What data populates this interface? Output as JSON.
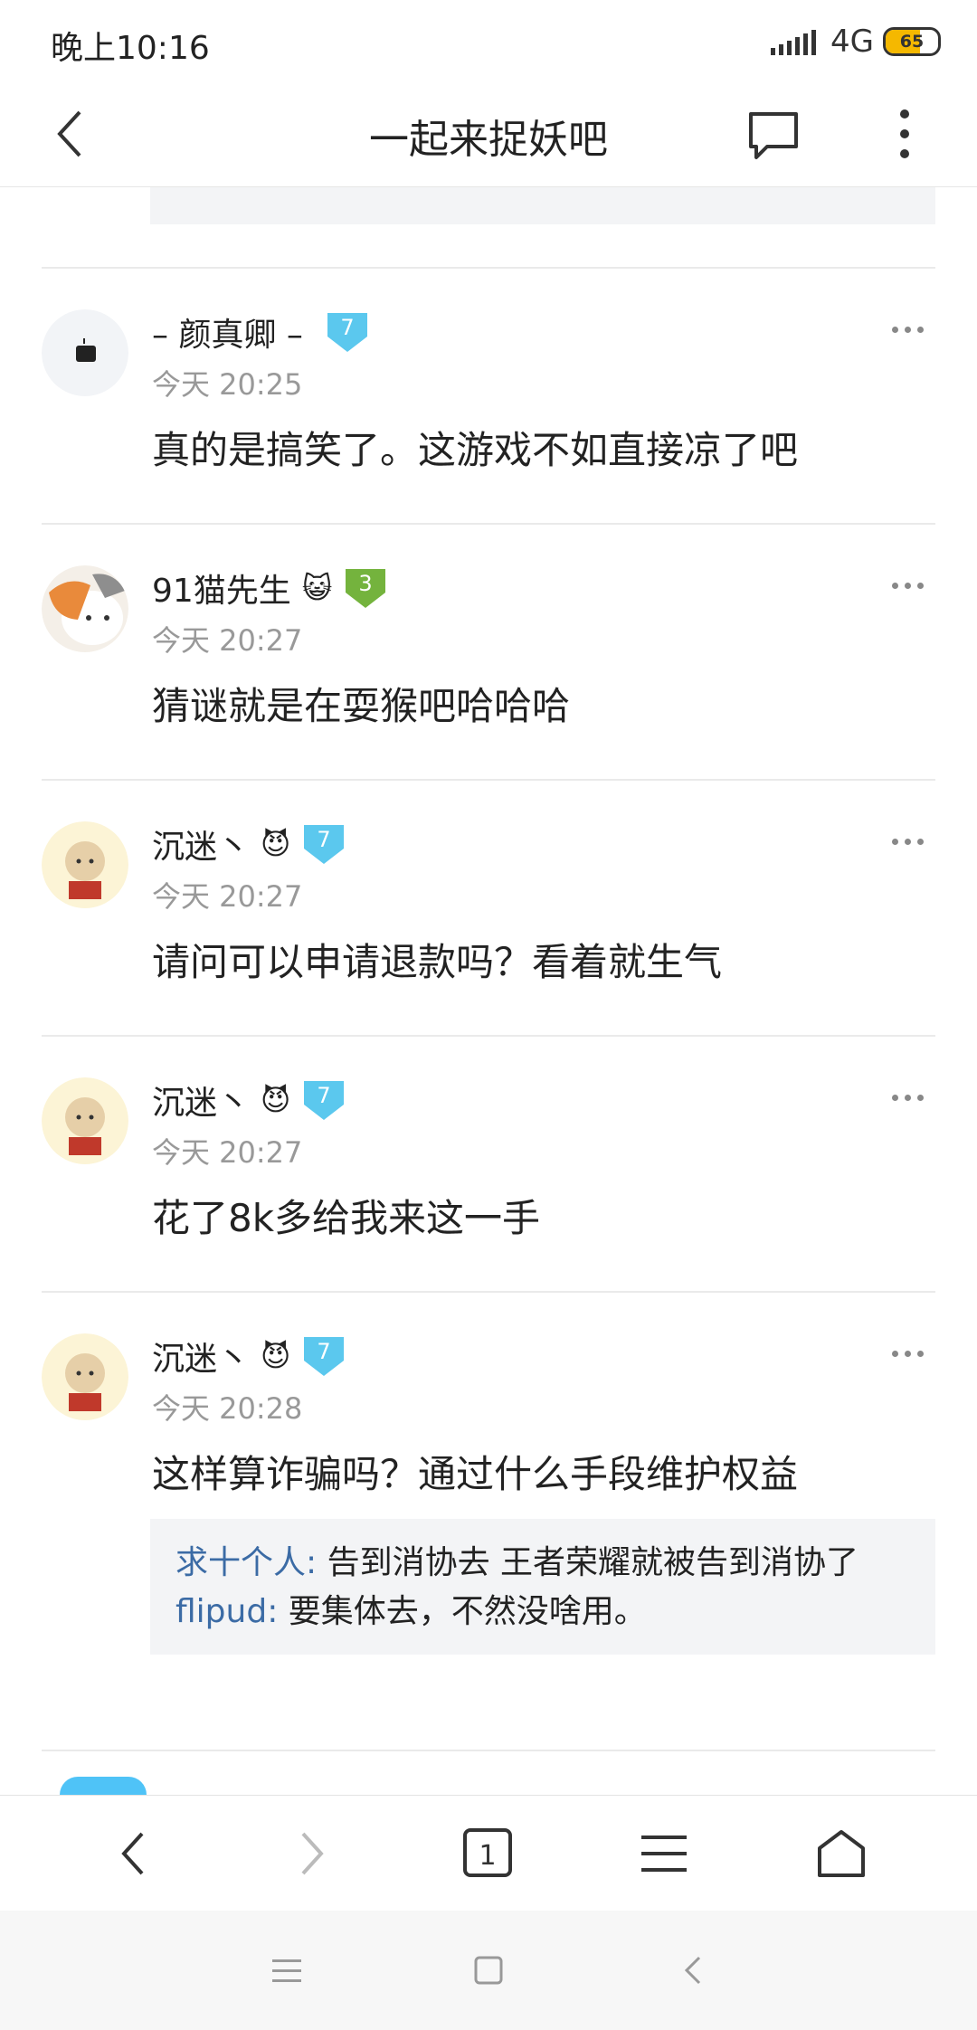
{
  "status": {
    "time": "晚上10:16",
    "network": "4G",
    "battery": "65",
    "battery_level": 0.65
  },
  "header": {
    "title": "一起来捉妖吧"
  },
  "posts": [
    {
      "user": "– 颜真卿 –",
      "level": "7",
      "level_color": "#5bc8ee",
      "emoji": "",
      "time": "今天 20:25",
      "text": "真的是搞笑了。这游戏不如直接凉了吧"
    },
    {
      "user": "91猫先生",
      "level": "3",
      "level_color": "#74b33d",
      "emoji": "😺",
      "time": "今天 20:27",
      "text": "猜谜就是在耍猴吧哈哈哈"
    },
    {
      "user": "沉迷丶",
      "level": "7",
      "level_color": "#5bc8ee",
      "emoji": "😈",
      "time": "今天 20:27",
      "text": "请问可以申请退款吗？看着就生气"
    },
    {
      "user": "沉迷丶",
      "level": "7",
      "level_color": "#5bc8ee",
      "emoji": "😈",
      "time": "今天 20:27",
      "text": "花了8k多给我来这一手"
    },
    {
      "user": "沉迷丶",
      "level": "7",
      "level_color": "#5bc8ee",
      "emoji": "😈",
      "time": "今天 20:28",
      "text": "这样算诈骗吗？通过什么手段维护权益",
      "replies": [
        {
          "name": "求十个人:",
          "text": " 告到消协去 王者荣耀就被告到消协了"
        },
        {
          "name": "flipud:",
          "text": " 要集体去，不然没啥用。"
        }
      ]
    }
  ],
  "colors": {
    "link": "#3b6ba5",
    "meta": "#999999",
    "quote_bg": "#f3f4f6"
  },
  "toolbar": {
    "tab_count": "1"
  }
}
